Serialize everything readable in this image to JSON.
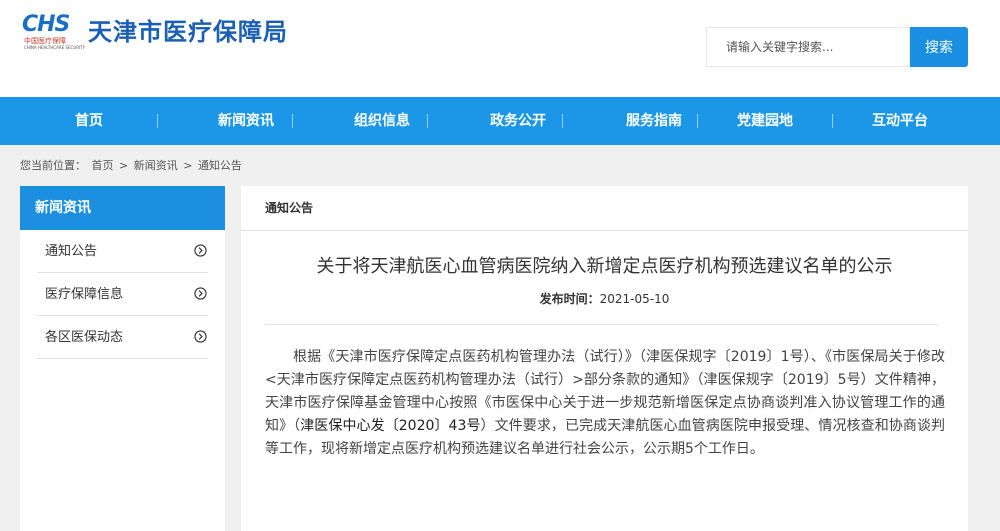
{
  "header": {
    "logo_text": "CHS",
    "logo_cn": "中国医疗保障",
    "logo_en": "CHINA HEALTHCARE SECURITY",
    "site_title": "天津市医疗保障局",
    "search_placeholder": "请输入关键字搜索...",
    "search_button": "搜索"
  },
  "nav": {
    "items": [
      {
        "label": "首页"
      },
      {
        "label": "新闻资讯"
      },
      {
        "label": "组织信息"
      },
      {
        "label": "政务公开"
      },
      {
        "label": "服务指南"
      },
      {
        "label": "党建园地"
      },
      {
        "label": "互动平台"
      }
    ]
  },
  "breadcrumb": {
    "prefix": "您当前位置：",
    "items": [
      "首页",
      "新闻资讯",
      "通知公告"
    ],
    "separator": ">"
  },
  "sidebar": {
    "title": "新闻资讯",
    "items": [
      {
        "label": "通知公告",
        "icon": "chevron-right-circle-icon"
      },
      {
        "label": "医疗保障信息",
        "icon": "chevron-right-circle-icon"
      },
      {
        "label": "各区医保动态",
        "icon": "chevron-right-circle-icon"
      }
    ]
  },
  "main": {
    "tab": "通知公告",
    "title": "关于将天津航医心血管病医院纳入新增定点医疗机构预选建议名单的公示",
    "pubdate_label": "发布时间：",
    "pubdate": "2021-05-10",
    "body_part1": "根据《天津市医疗保障定点医药机构管理办法（试行）》（津医保规字〔2019〕1号）、《市医保局关于修改<天津市医疗保障定点医药机构管理办法（试行）>部分条款的通知》（津医保规字〔2019〕5号）文件精神，天津市医疗保障基金管理中心按照《市医保中心关于进一步规范新增医保定点协商谈判准入协议管理工作的通知》（",
    "body_highlight": "津医保中心发〔2020〕43号",
    "body_part2": "）文件要求，已完成天津航医心血管病医院申报受理、情况核查和协商谈判等工作，现将新增定点医疗机构预选建议名单进行社会公示，公示期5个工作日。"
  },
  "colors": {
    "primary": "#1c97e8",
    "title_blue": "#1a5fb4",
    "page_bg": "#f0f0f0"
  }
}
